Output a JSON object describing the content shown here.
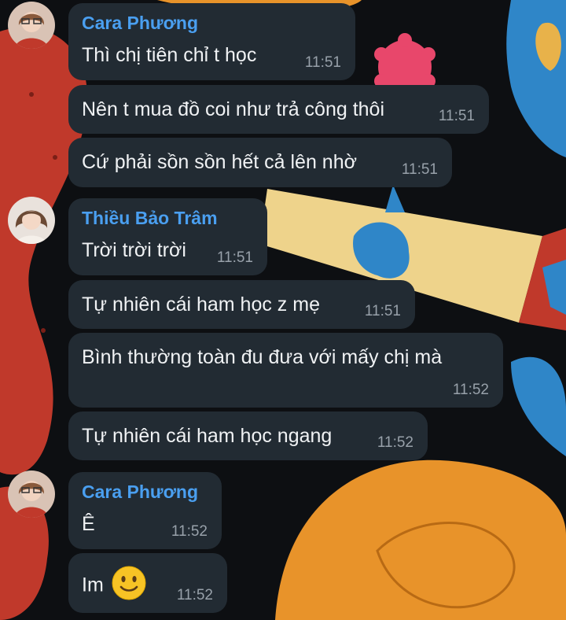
{
  "colors": {
    "bubble": "#222b33",
    "sender_name": "#4a9ff0",
    "message_text": "#f0f2f4",
    "timestamp": "#98a1aa",
    "wallpaper": "#0d0f12"
  },
  "messages": [
    {
      "sender": "Cara Phương",
      "text": "Thì chị tiên chỉ t học",
      "time": "11:51"
    },
    {
      "text": "Nên t mua đồ coi như trả công thôi",
      "time": "11:51"
    },
    {
      "text": "Cứ phải sồn sồn hết cả lên nhờ",
      "time": "11:51"
    },
    {
      "sender": "Thiều Bảo Trâm",
      "text": "Trời trời trời",
      "time": "11:51"
    },
    {
      "text": "Tự nhiên cái ham học z mẹ",
      "time": "11:51"
    },
    {
      "text": "Bình thường toàn đu đưa với mấy chị mà",
      "time": "11:52"
    },
    {
      "text": "Tự nhiên cái ham học ngang",
      "time": "11:52"
    },
    {
      "sender": "Cara Phương",
      "text": "Ê",
      "time": "11:52"
    },
    {
      "text": "Im",
      "emoji": "slightly-smiling-face-icon",
      "time": "11:52"
    }
  ]
}
